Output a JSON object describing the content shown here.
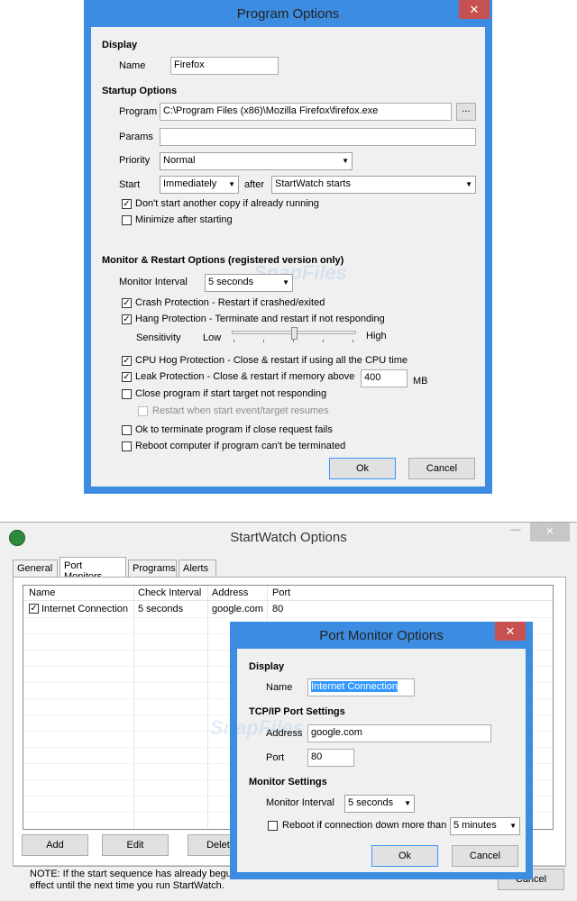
{
  "colors": {
    "window_border": "#3c8de2",
    "close_button": "#c75050",
    "client_bg": "#f0f0f0"
  },
  "program_options": {
    "title": "Program Options",
    "close_glyph": "✕",
    "display_heading": "Display",
    "name_label": "Name",
    "name_value": "Firefox",
    "startup_heading": "Startup Options",
    "program_label": "Program",
    "program_value": "C:\\Program Files (x86)\\Mozilla Firefox\\firefox.exe",
    "browse_label": "...",
    "params_label": "Params",
    "params_value": "",
    "priority_label": "Priority",
    "priority_value": "Normal",
    "start_label": "Start",
    "start_value": "Immediately",
    "after_label": "after",
    "after_value": "StartWatch starts",
    "dont_start_copy": {
      "label": "Don't start another copy if already running",
      "checked": true
    },
    "minimize_after": {
      "label": "Minimize after starting",
      "checked": false
    },
    "monitor_heading": "Monitor & Restart Options (registered version only)",
    "monitor_interval_label": "Monitor Interval",
    "monitor_interval_value": "5 seconds",
    "crash_protection": {
      "label": "Crash Protection - Restart if crashed/exited",
      "checked": true
    },
    "hang_protection": {
      "label": "Hang Protection - Terminate and restart if not responding",
      "checked": true
    },
    "sensitivity_label": "Sensitivity",
    "sensitivity_low": "Low",
    "sensitivity_high": "High",
    "sensitivity_level": 0.5,
    "cpu_hog": {
      "label": "CPU Hog Protection - Close & restart if using all the CPU time",
      "checked": true
    },
    "leak_protection": {
      "label": "Leak Protection - Close & restart if memory above",
      "checked": true
    },
    "leak_value": "400",
    "leak_unit": "MB",
    "close_not_responding": {
      "label": "Close program if start target not responding",
      "checked": false
    },
    "restart_when_start": {
      "label": "Restart when start event/target resumes",
      "checked": false
    },
    "ok_terminate": {
      "label": "Ok to terminate program if close request fails",
      "checked": false
    },
    "reboot_computer": {
      "label": "Reboot computer if program can't be terminated",
      "checked": false
    },
    "ok_button": "Ok",
    "cancel_button": "Cancel"
  },
  "startwatch_options": {
    "title": "StartWatch Options",
    "minimize_glyph": "—",
    "tabs": [
      "General",
      "Port Monitors",
      "Programs",
      "Alerts"
    ],
    "active_tab": "Port Monitors",
    "columns": [
      "Name",
      "Check Interval",
      "Address",
      "Port"
    ],
    "rows": [
      {
        "checked": true,
        "name": "Internet Connection",
        "interval": "5 seconds",
        "address": "google.com",
        "port": "80"
      }
    ],
    "add_button": "Add",
    "edit_button": "Edit",
    "delete_button": "Delete",
    "note": "NOTE: If the start sequence has already begun",
    "note_line2": "effect until the next time you run StartWatch.",
    "cancel_partial": "Cancel"
  },
  "port_monitor_options": {
    "title": "Port Monitor Options",
    "close_glyph": "✕",
    "display_heading": "Display",
    "name_label": "Name",
    "name_value": "Internet Connection",
    "tcp_heading": "TCP/IP Port Settings",
    "address_label": "Address",
    "address_value": "google.com",
    "port_label": "Port",
    "port_value": "80",
    "monitor_heading": "Monitor Settings",
    "monitor_interval_label": "Monitor Interval",
    "monitor_interval_value": "5 seconds",
    "reboot_label": "Reboot if connection down more than",
    "reboot_checked": false,
    "reboot_value": "5 minutes",
    "ok_button": "Ok",
    "cancel_button": "Cancel"
  },
  "watermark": "SnapFiles"
}
